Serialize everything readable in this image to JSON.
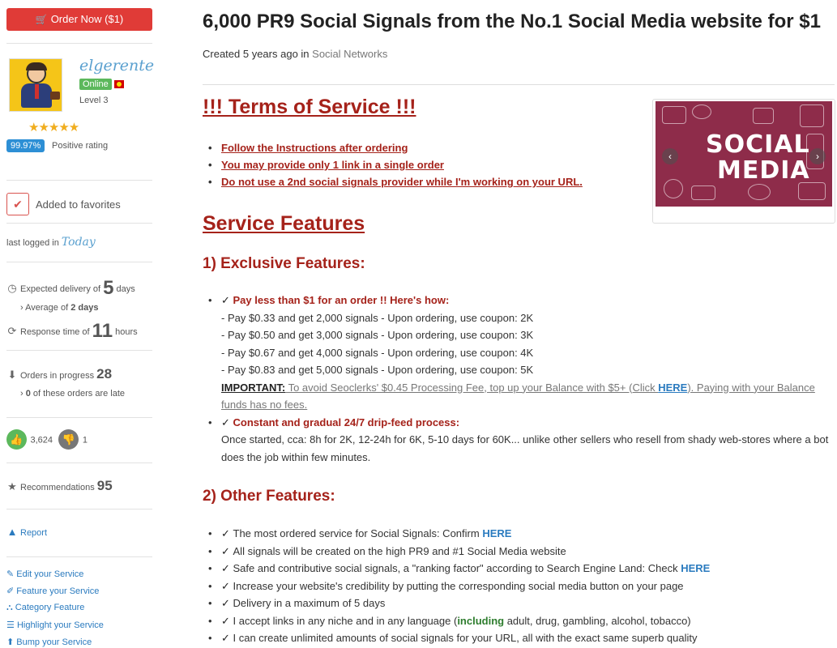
{
  "sidebar": {
    "order_label": "Order Now ($1)",
    "username": "elgerente",
    "online": "Online",
    "level": "Level 3",
    "stars": "★★★★★",
    "rating_percent": "99.97%",
    "rating_text": "Positive rating",
    "favorites": "Added to favorites",
    "last_logged_prefix": "last logged in",
    "last_logged_value": "Today",
    "expected_prefix": "Expected delivery of",
    "expected_value": "5",
    "expected_unit": "days",
    "average_prefix": "Average of",
    "average_value": "2 days",
    "response_prefix": "Response time of",
    "response_value": "11",
    "response_unit": "hours",
    "orders_prefix": "Orders in progress",
    "orders_value": "28",
    "late_value": "0",
    "late_suffix": "of these orders are late",
    "thumbs_up": "3,624",
    "thumbs_down": "1",
    "recs_prefix": "Recommendations",
    "recs_value": "95",
    "report": "Report",
    "links": [
      "Edit your Service",
      "Feature your Service",
      "Category Feature",
      "Highlight your Service",
      "Bump your Service"
    ]
  },
  "main": {
    "title": "6,000 PR9 Social Signals from the No.1 Social Media website for $1",
    "created_prefix": "Created 5 years ago in",
    "category": "Social Networks",
    "tos_heading": "!!! Terms of Service !!!",
    "tos_items": [
      "Follow the Instructions after ordering",
      "You may provide only 1 link in a single order",
      "Do not use a 2nd social signals provider while I'm working on your URL."
    ],
    "features_heading": "Service Features",
    "excl_heading": "1) Exclusive Features:",
    "pay_less": "Pay less than $1 for an order !! Here's how:",
    "pay_lines": [
      "- Pay $0.33 and get 2,000 signals - Upon ordering, use coupon: 2K",
      "- Pay $0.50 and get 3,000 signals - Upon ordering, use coupon: 3K",
      "- Pay $0.67 and get 4,000 signals - Upon ordering, use coupon: 4K",
      "- Pay $0.83 and get 5,000 signals - Upon ordering, use coupon: 5K"
    ],
    "important_label": "IMPORTANT:",
    "important_text_1": " To avoid Seoclerks' $0.45 Processing Fee, top up your Balance with $5+ (Click ",
    "important_here": "HERE",
    "important_text_2": "). Paying with your Balance",
    "important_text_3": "funds has no fees.",
    "drip_title": "Constant and gradual 24/7 drip-feed process:",
    "drip_line_1": "Once started, cca: 8h for 2K, 12-24h for 6K, 5-10 days for 60K... unlike other sellers who resell from shady web-stores where a bot",
    "drip_line_2": "does the job within few minutes.",
    "other_heading": "2) Other Features:",
    "other_1": "The most ordered service for Social Signals: Confirm ",
    "other_1_here": "HERE",
    "other_2": "All signals will be created on the high PR9 and #1 Social Media website",
    "other_3": "Safe and contributive social signals, a \"ranking factor\" according to Search Engine Land: Check ",
    "other_3_here": "HERE",
    "other_4": "Increase your website's credibility by putting the corresponding social media button on your page",
    "other_5": "Delivery in a maximum of 5 days",
    "other_6_a": "I accept links in any niche and in any language (",
    "other_6_incl": "including",
    "other_6_b": " adult, drug, gambling, alcohol, tobacco)",
    "other_7": "I can create unlimited amounts of social signals for your URL, all with the exact same superb quality"
  },
  "media": {
    "word1": "SOCIAL",
    "word2": "MEDIA",
    "prev_icon": "‹",
    "next_icon": "›"
  },
  "colors": {
    "accent_red": "#a5221a",
    "button_red": "#e03b37",
    "link_blue": "#2b7bbf",
    "online_green": "#5cb85c",
    "image_bg": "#8e2c4a"
  }
}
